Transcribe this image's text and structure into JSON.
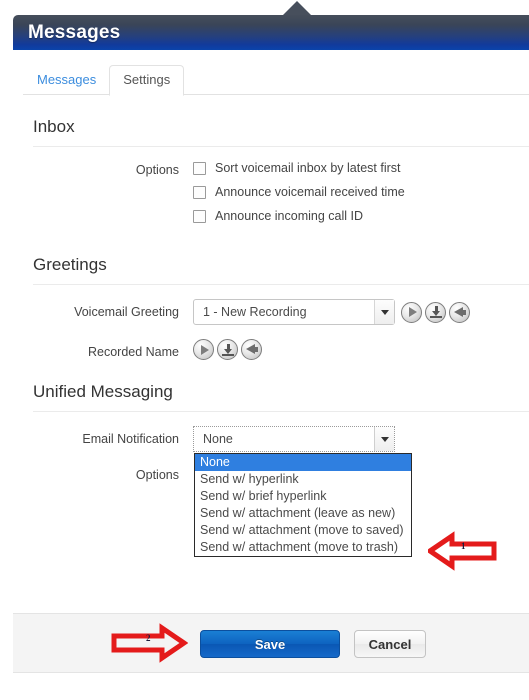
{
  "panel": {
    "title": "Messages"
  },
  "tabs": [
    {
      "label": "Messages",
      "active": false
    },
    {
      "label": "Settings",
      "active": true
    }
  ],
  "sections": {
    "inbox": {
      "title": "Inbox",
      "options_label": "Options",
      "checkboxes": [
        {
          "label": "Sort voicemail inbox by latest first",
          "checked": false
        },
        {
          "label": "Announce voicemail received time",
          "checked": false
        },
        {
          "label": "Announce incoming call ID",
          "checked": false
        }
      ]
    },
    "greetings": {
      "title": "Greetings",
      "voicemail_greeting": {
        "label": "Voicemail Greeting",
        "value": "1 - New Recording"
      },
      "recorded_name": {
        "label": "Recorded Name"
      },
      "media_buttons": [
        "play-icon",
        "download-icon",
        "speaker-icon"
      ]
    },
    "unified_messaging": {
      "title": "Unified Messaging",
      "email_notification": {
        "label": "Email Notification",
        "value": "None",
        "options": [
          "None",
          "Send w/ hyperlink",
          "Send w/ brief hyperlink",
          "Send w/ attachment (leave as new)",
          "Send w/ attachment (move to saved)",
          "Send w/ attachment (move to trash)"
        ],
        "selected_index": 0
      },
      "options_label": "Options"
    }
  },
  "footer": {
    "save_label": "Save",
    "cancel_label": "Cancel"
  },
  "annotations": [
    {
      "number": "1",
      "direction": "left",
      "color": "#e41b1b"
    },
    {
      "number": "2",
      "direction": "right",
      "color": "#e41b1b"
    }
  ],
  "colors": {
    "header_blue": "#0b44ab",
    "header_dark": "#464e5b",
    "tab_link": "#3c8dde",
    "save_blue": "#0e63c0",
    "highlight_blue": "#2f7fe0",
    "annotation_red": "#e41b1b"
  }
}
